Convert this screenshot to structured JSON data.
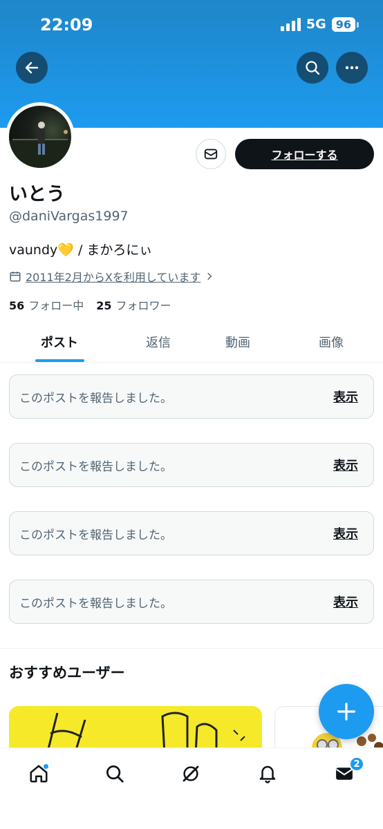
{
  "status_bar": {
    "time": "22:09",
    "network": "5G",
    "battery": "96"
  },
  "profile": {
    "display_name": "いとう",
    "handle": "@daniVargas1997",
    "bio": "vaundy💛 / まかろにぃ",
    "joined": "2011年2月からXを利用しています",
    "following_count": "56",
    "following_label": "フォロー中",
    "followers_count": "25",
    "followers_label": "フォロワー"
  },
  "actions": {
    "follow_label": "フォローする"
  },
  "tabs": [
    {
      "label": "ポスト",
      "active": true
    },
    {
      "label": "返信",
      "active": false
    },
    {
      "label": "動画",
      "active": false
    },
    {
      "label": "画像",
      "active": false
    }
  ],
  "reported_posts": [
    {
      "text": "このポストを報告しました。",
      "action": "表示"
    },
    {
      "text": "このポストを報告しました。",
      "action": "表示"
    },
    {
      "text": "このポストを報告しました。",
      "action": "表示"
    },
    {
      "text": "このポストを報告しました。",
      "action": "表示"
    }
  ],
  "recommendations": {
    "title": "おすすめユーザー"
  },
  "bottom_nav": {
    "items": [
      {
        "icon": "home-icon",
        "notify_dot": true
      },
      {
        "icon": "search-icon"
      },
      {
        "icon": "grok-icon"
      },
      {
        "icon": "bell-icon"
      },
      {
        "icon": "mail-icon",
        "badge": "2"
      }
    ]
  },
  "colors": {
    "accent": "#1d9bf0",
    "text": "#0f1419",
    "muted": "#536471",
    "banner": "#1f86c9"
  }
}
